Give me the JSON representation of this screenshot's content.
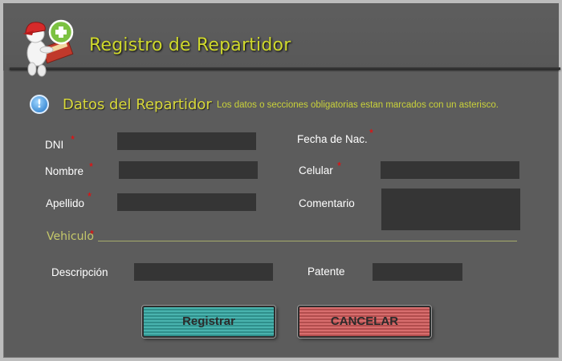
{
  "header": {
    "title": "Registro de Repartidor",
    "logo_icon": "delivery-man-add-icon"
  },
  "section": {
    "title": "Datos del Repartidor",
    "note": "Los  datos o secciones obligatorias estan marcados con un asterisco.",
    "info_icon": "info-icon"
  },
  "required_mark": "*",
  "fields": {
    "dni": {
      "label": "DNI",
      "value": ""
    },
    "nombre": {
      "label": "Nombre",
      "value": ""
    },
    "apellido": {
      "label": "Apellido",
      "value": ""
    },
    "fecha_nac": {
      "label": "Fecha de Nac.",
      "value": ""
    },
    "celular": {
      "label": "Celular",
      "value": ""
    },
    "comentario": {
      "label": "Comentario",
      "value": ""
    }
  },
  "vehiculo": {
    "title": "Vehiculo",
    "descripcion": {
      "label": "Descripción",
      "value": ""
    },
    "patente": {
      "label": "Patente",
      "value": ""
    }
  },
  "buttons": {
    "registrar": "Registrar",
    "cancelar": "CANCELAR"
  },
  "colors": {
    "title": "#cfd82c",
    "required": "#ff0000",
    "registrar_button": "#49b3ae",
    "cancelar_button": "#d86e6e"
  }
}
